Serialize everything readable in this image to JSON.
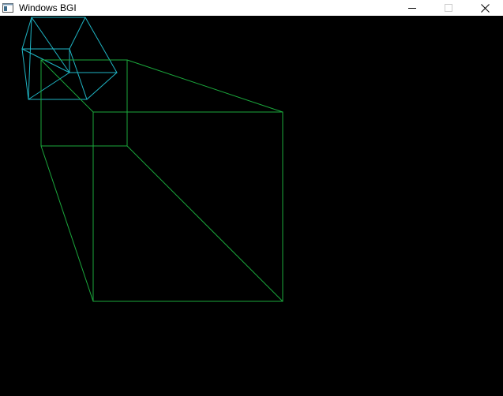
{
  "window": {
    "title": "Windows BGI",
    "app_icon": "bgi-window-icon",
    "controls": {
      "minimize": "minimize-icon",
      "maximize": "maximize-icon",
      "close": "close-icon"
    }
  },
  "colors": {
    "background": "#000000",
    "small_cube": "#1fb5c4",
    "large_cube": "#1ba83c",
    "titlebar": "#ffffff"
  }
}
